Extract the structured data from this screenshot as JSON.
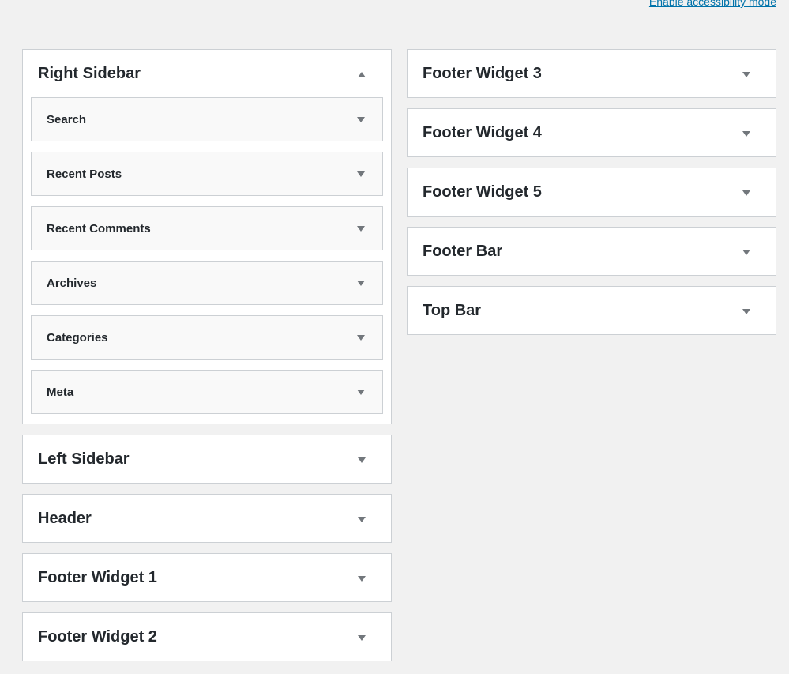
{
  "header": {
    "accessibility_link": "Enable accessibility mode"
  },
  "left_column": [
    {
      "title": "Right Sidebar",
      "expanded": true,
      "widgets": [
        "Search",
        "Recent Posts",
        "Recent Comments",
        "Archives",
        "Categories",
        "Meta"
      ]
    },
    {
      "title": "Left Sidebar",
      "expanded": false
    },
    {
      "title": "Header",
      "expanded": false
    },
    {
      "title": "Footer Widget 1",
      "expanded": false
    },
    {
      "title": "Footer Widget 2",
      "expanded": false
    }
  ],
  "right_column": [
    {
      "title": "Footer Widget 3",
      "expanded": false
    },
    {
      "title": "Footer Widget 4",
      "expanded": false
    },
    {
      "title": "Footer Widget 5",
      "expanded": false
    },
    {
      "title": "Footer Bar",
      "expanded": false
    },
    {
      "title": "Top Bar",
      "expanded": false
    }
  ],
  "icons": {
    "collapse": "arrow-up-icon",
    "expand": "arrow-down-icon"
  },
  "colors": {
    "link": "#0073aa",
    "arrow": "#72777c",
    "border": "#ccd0d4"
  }
}
